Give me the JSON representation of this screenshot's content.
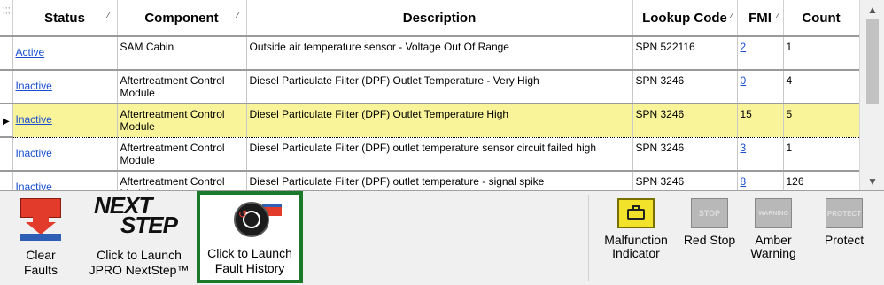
{
  "grid": {
    "headers": {
      "status": "Status",
      "component": "Component",
      "description": "Description",
      "lookup_code": "Lookup Code",
      "fmi": "FMI",
      "count": "Count"
    },
    "rows": [
      {
        "status": "Active",
        "component": "SAM Cabin",
        "description": "Outside air temperature sensor - Voltage Out Of Range",
        "lookup_code": "SPN 522116",
        "fmi": "2",
        "count": "1"
      },
      {
        "status": "Inactive",
        "component": "Aftertreatment Control Module",
        "description": "Diesel Particulate Filter (DPF) Outlet Temperature - Very High",
        "lookup_code": "SPN 3246",
        "fmi": "0",
        "count": "4"
      },
      {
        "status": "Inactive",
        "component": "Aftertreatment Control Module",
        "description": "Diesel Particulate Filter (DPF) Outlet Temperature High",
        "lookup_code": "SPN 3246",
        "fmi": "15",
        "count": "5"
      },
      {
        "status": "Inactive",
        "component": "Aftertreatment Control Module",
        "description": "Diesel Particulate Filter (DPF) outlet temperature sensor circuit failed high",
        "lookup_code": "SPN 3246",
        "fmi": "3",
        "count": "1"
      },
      {
        "status": "Inactive",
        "component": "Aftertreatment Control Module",
        "description": "Diesel Particulate Filter (DPF) outlet temperature - signal spike",
        "lookup_code": "SPN 3246",
        "fmi": "8",
        "count": "126"
      }
    ],
    "selected_row_index": 2
  },
  "toolbar": {
    "clear_faults": "Clear Faults",
    "nextstep_logo_top": "NEXT",
    "nextstep_logo_bottom": "STEP",
    "nextstep_label": "Click to Launch JPRO NextStep™",
    "fault_history_label": "Click to Launch Fault History",
    "malfunction_label": "Malfunction Indicator",
    "red_stop_label": "Red Stop",
    "red_stop_lamp": "STOP",
    "amber_label": "Amber Warning",
    "amber_lamp": "WARNING",
    "protect_label": "Protect",
    "protect_lamp": "PROTECT"
  },
  "colors": {
    "selected_row": "#f9f49a",
    "link": "#1a4fd0",
    "malfunction_lamp": "#f2e22a",
    "fault_history_border": "#1a7a2a"
  },
  "icons": {
    "clear_faults": "clear-faults-icon",
    "fault_history": "clock-history-icon",
    "malfunction": "engine-icon"
  }
}
